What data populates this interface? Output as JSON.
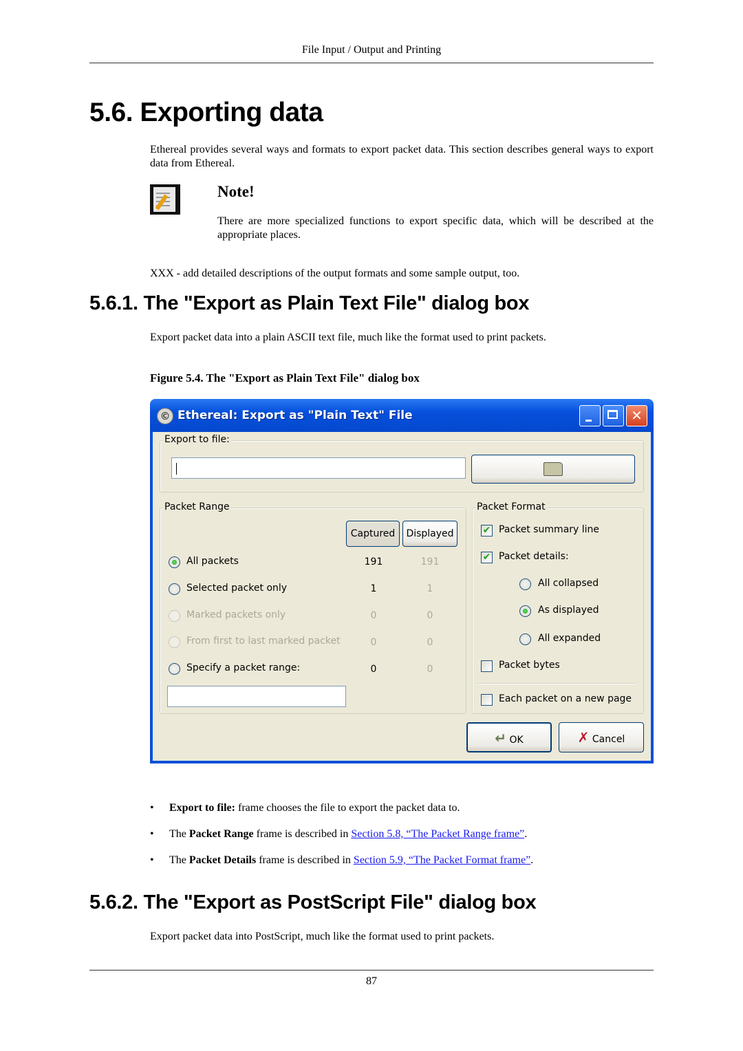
{
  "running_header": "File Input / Output and Printing",
  "section": {
    "title": "5.6. Exporting data",
    "intro": "Ethereal provides several ways and formats to export packet data. This section describes general ways to export data from Ethereal.",
    "note": {
      "icon": "note-pencil-icon",
      "title": "Note!",
      "text": "There are more specialized functions to export specific data, which will be described at the appropriate places."
    },
    "todo": "XXX - add detailed descriptions of the output formats and some sample output, too."
  },
  "subsection1": {
    "title": "5.6.1. The \"Export as Plain Text File\" dialog box",
    "text": "Export packet data into a plain ASCII text file, much like the format used to print packets.",
    "figure_caption": "Figure 5.4. The \"Export as Plain Text File\" dialog box",
    "bullets": [
      {
        "bold": "Export to file:",
        "text": " frame chooses the file to export the packet data to.",
        "prefix": "",
        "link": "",
        "suffix": ""
      },
      {
        "prefix": "The ",
        "bold": "Packet Range",
        "text": " frame is described in ",
        "link": "Section 5.8, “The Packet Range frame”",
        "suffix": "."
      },
      {
        "prefix": "The ",
        "bold": "Packet Details",
        "text": " frame is described in ",
        "link": "Section 5.9, “The Packet Format frame”",
        "suffix": "."
      }
    ]
  },
  "dialog": {
    "title": "Ethereal: Export as \"Plain Text\" File",
    "export_frame_label": "Export to file:",
    "file_input_value": "",
    "browse_icon": "folder-open-icon",
    "packet_range": {
      "label": "Packet Range",
      "captured_btn": "Captured",
      "displayed_btn": "Displayed",
      "rows": [
        {
          "label": "All packets",
          "captured": "191",
          "displayed": "191",
          "checked": true,
          "disabled": false
        },
        {
          "label": "Selected packet only",
          "captured": "1",
          "displayed": "1",
          "checked": false,
          "disabled": false
        },
        {
          "label": "Marked packets only",
          "captured": "0",
          "displayed": "0",
          "checked": false,
          "disabled": true
        },
        {
          "label": "From first to last marked packet",
          "captured": "0",
          "displayed": "0",
          "checked": false,
          "disabled": true
        },
        {
          "label": "Specify a packet range:",
          "captured": "0",
          "displayed": "0",
          "checked": false,
          "disabled": false
        }
      ],
      "range_input_value": ""
    },
    "packet_format": {
      "label": "Packet Format",
      "summary_line": {
        "label": "Packet summary line",
        "checked": true
      },
      "details": {
        "label": "Packet details:",
        "checked": true
      },
      "details_options": [
        {
          "label": "All collapsed",
          "checked": false
        },
        {
          "label": "As displayed",
          "checked": true
        },
        {
          "label": "All expanded",
          "checked": false
        }
      ],
      "bytes": {
        "label": "Packet bytes",
        "checked": false
      },
      "new_page": {
        "label": "Each packet on a new page",
        "checked": false
      }
    },
    "ok_label": "OK",
    "cancel_label": "Cancel"
  },
  "subsection2": {
    "title": "5.6.2. The \"Export as PostScript File\" dialog box",
    "text": "Export packet data into PostScript, much like the format used to print packets."
  },
  "page_number": "87",
  "colors": {
    "link": "#1a1aee",
    "titlebar": "#0650dc",
    "dialog_bg": "#ece9d8"
  }
}
